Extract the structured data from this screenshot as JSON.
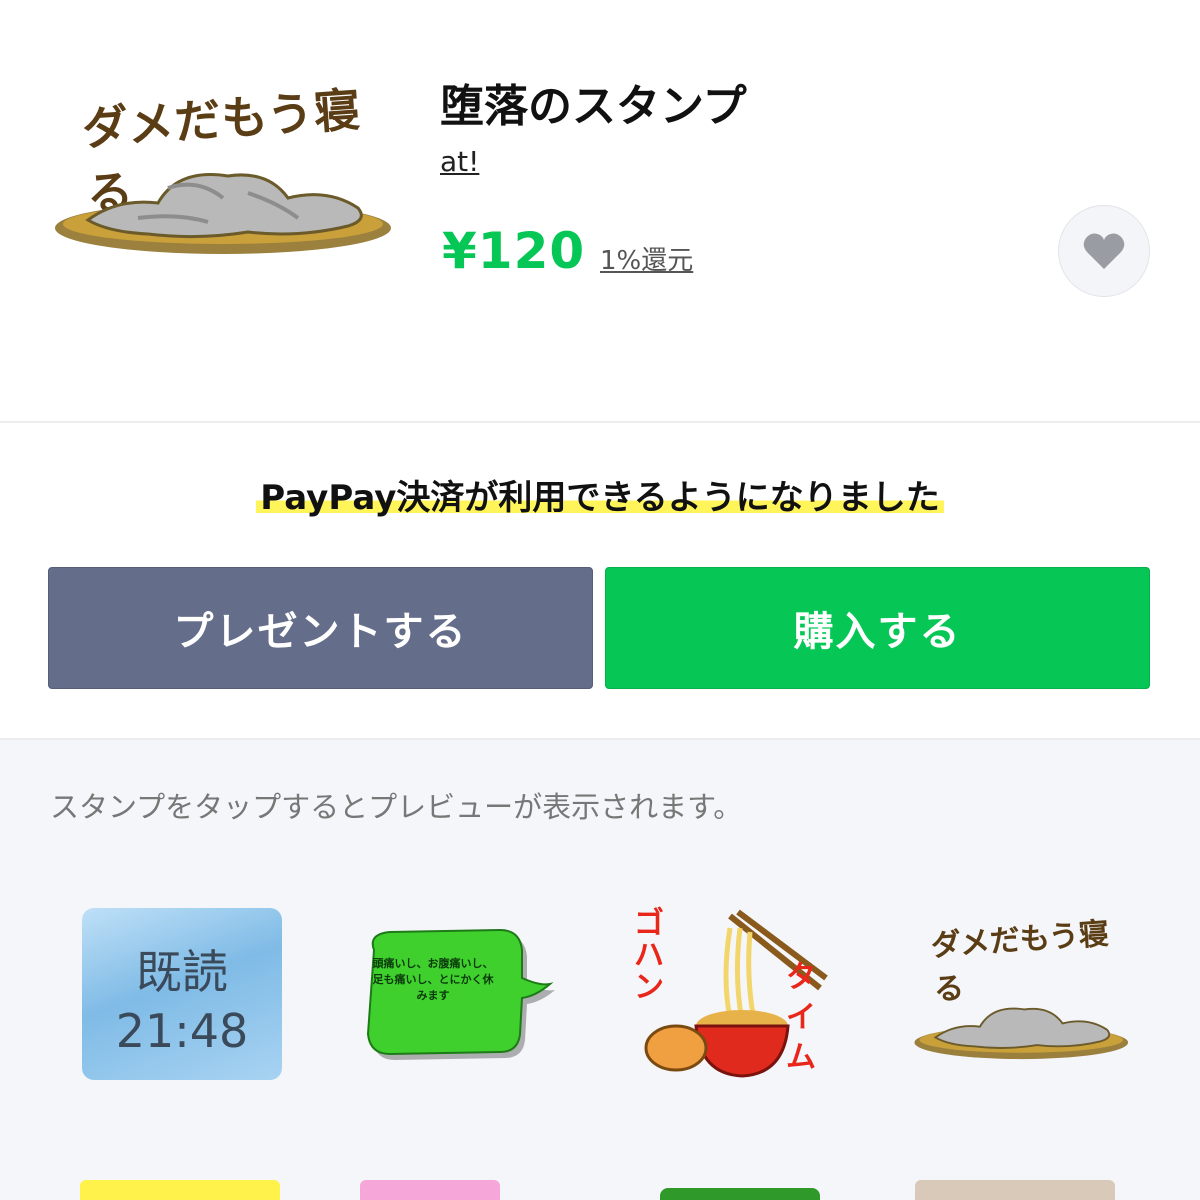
{
  "product": {
    "title": "堕落のスタンプ",
    "author": "at!",
    "price": "¥120",
    "cashback": "1%還元",
    "main_image_caption": "ダメだもう寝る"
  },
  "notice": {
    "text": "PayPay決済が利用できるようになりました"
  },
  "buttons": {
    "gift_label": "プレゼントする",
    "buy_label": "購入する"
  },
  "preview": {
    "hint": "スタンプをタップするとプレビューが表示されます。",
    "stickers": [
      {
        "line1": "既読",
        "line2": "21:48"
      },
      {
        "text": "頭痛いし、お腹痛いし、足も痛いし、とにかく休みます"
      },
      {
        "left_text": "ゴハン",
        "right_text": "タイム"
      },
      {
        "caption": "ダメだもう寝る"
      }
    ]
  },
  "colors": {
    "accent_green": "#06c755",
    "gift_button": "#646e8a",
    "highlight_yellow": "#fff45a",
    "preview_bg": "#f5f6f9"
  },
  "icons": {
    "favorite": "heart-icon"
  }
}
